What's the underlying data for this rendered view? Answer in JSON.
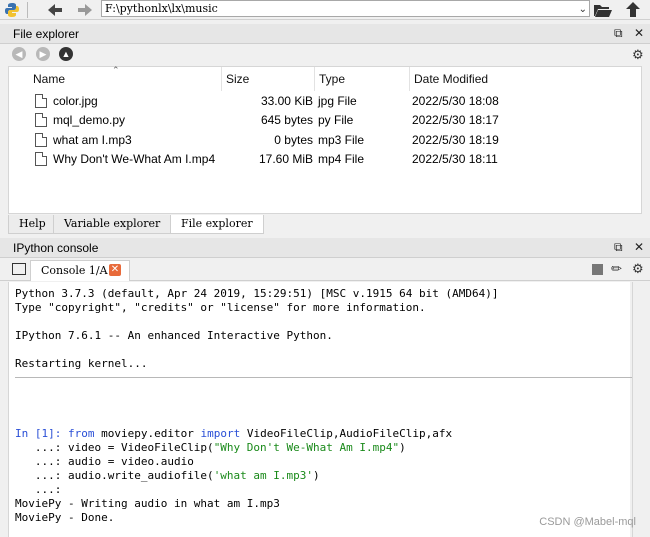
{
  "toolbar": {
    "path_value": "F:\\pythonlx\\lx\\music"
  },
  "file_explorer": {
    "title": "File explorer",
    "columns": {
      "name": "Name",
      "size": "Size",
      "type": "Type",
      "modified": "Date Modified"
    },
    "rows": [
      {
        "name": "color.jpg",
        "size": "33.00 KiB",
        "type": "jpg File",
        "modified": "2022/5/30 18:08"
      },
      {
        "name": "mql_demo.py",
        "size": "645 bytes",
        "type": "py File",
        "modified": "2022/5/30 18:17"
      },
      {
        "name": "what am I.mp3",
        "size": "0 bytes",
        "type": "mp3 File",
        "modified": "2022/5/30 18:19"
      },
      {
        "name": "Why Don't We-What Am I.mp4",
        "size": "17.60 MiB",
        "type": "mp4 File",
        "modified": "2022/5/30 18:11"
      }
    ]
  },
  "bottom_tabs": [
    "Help",
    "Variable explorer",
    "File explorer"
  ],
  "ipython": {
    "title": "IPython console",
    "tab_label": "Console 1/A",
    "lines": [
      "Python 3.7.3 (default, Apr 24 2019, 15:29:51) [MSC v.1915 64 bit (AMD64)]",
      "Type \"copyright\", \"credits\" or \"license\" for more information.",
      "",
      "IPython 7.6.1 -- An enhanced Interactive Python.",
      "",
      "Restarting kernel..."
    ],
    "prompt_in": "In [1]:",
    "code_1_from": "from",
    "code_1_module": " moviepy.editor ",
    "code_1_import": "import",
    "code_1_rest": " VideoFileClip,AudioFileClip,afx",
    "cont_prompt": "   ...:",
    "code_2_pre": " video = VideoFileClip(",
    "code_2_str": "\"Why Don't We-What Am I.mp4\"",
    "code_2_post": ")",
    "code_3": " audio = video.audio",
    "code_4_pre": " audio.write_audiofile(",
    "code_4_str": "'what am I.mp3'",
    "code_4_post": ")",
    "output_1": "MoviePy - Writing audio in what am I.mp3",
    "output_2": "MoviePy - Done."
  },
  "watermark": "CSDN @Mabel-mql",
  "colors": {
    "accent": "#2a4fd6",
    "string": "#1a8a1a",
    "close_tab": "#e86a3a"
  }
}
